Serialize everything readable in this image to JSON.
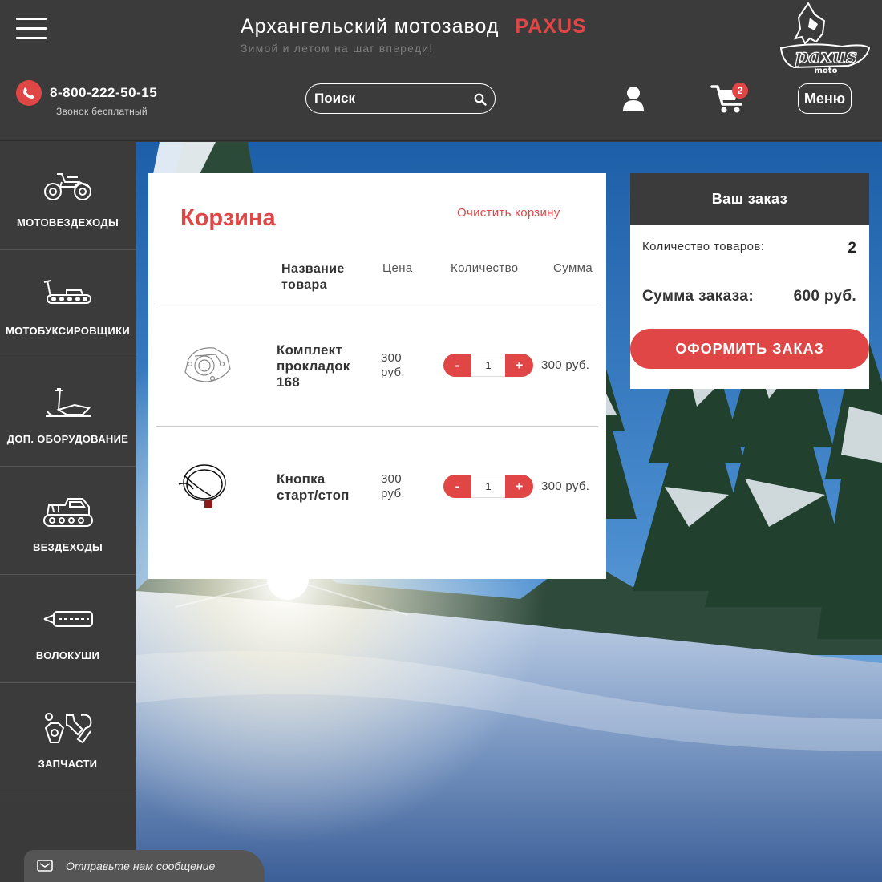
{
  "header": {
    "brand_name": "Архангельский мотозавод",
    "brand_accent": "PAXUS",
    "tagline": "Зимой и летом на шаг впереди!",
    "logo_text": "paxus",
    "logo_sub": "moto",
    "phone": "8-800-222-50-15",
    "phone_note": "Звонок бесплатный",
    "search_placeholder": "Поиск",
    "cart_count": "2",
    "menu_label": "Меню"
  },
  "sidebar": {
    "items": [
      {
        "label": "МОТОВЕЗДЕХОДЫ",
        "icon": "atv-icon"
      },
      {
        "label": "МОТОБУКСИРОВЩИКИ",
        "icon": "motor-tug-icon"
      },
      {
        "label": "ДОП. ОБОРУДОВАНИЕ",
        "icon": "plow-icon"
      },
      {
        "label": "ВЕЗДЕХОДЫ",
        "icon": "tracked-vehicle-icon"
      },
      {
        "label": "ВОЛОКУШИ",
        "icon": "sled-icon"
      },
      {
        "label": "ЗАПЧАСТИ",
        "icon": "spare-parts-icon"
      }
    ]
  },
  "cart": {
    "title": "Корзина",
    "clear_label": "Очистить корзину",
    "columns": {
      "name": "Название товара",
      "price": "Цена",
      "qty": "Количество",
      "sum": "Сумма"
    },
    "items": [
      {
        "name": "Комплект прокладок 168",
        "price": "300 руб.",
        "qty": "1",
        "sum": "300 руб.",
        "minus": "-",
        "plus": "+",
        "image": "gasket-icon"
      },
      {
        "name": "Кнопка старт/стоп",
        "price": "300 руб.",
        "qty": "1",
        "sum": "300 руб.",
        "minus": "-",
        "plus": "+",
        "image": "start-stop-cable-icon"
      }
    ]
  },
  "order": {
    "title": "Ваш заказ",
    "count_label": "Количество товаров:",
    "count_value": "2",
    "sum_label": "Сумма заказа:",
    "sum_value": "600 руб.",
    "button_label": "ОФОРМИТЬ ЗАКАЗ"
  },
  "widget": {
    "message": "Отправьте нам сообщение"
  },
  "colors": {
    "accent": "#e04646",
    "dark": "#3b3b3b",
    "sky": "#2a6fb5"
  }
}
